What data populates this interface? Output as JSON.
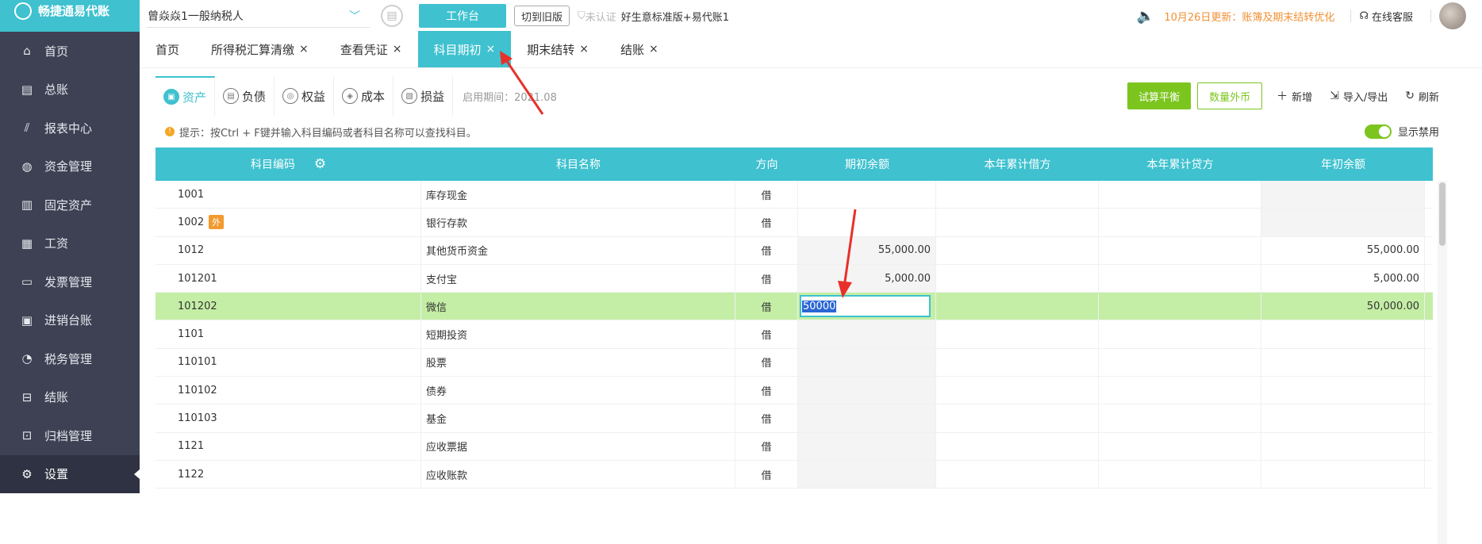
{
  "brand": {
    "name": "畅捷通易代账"
  },
  "sidebar": {
    "items": [
      {
        "label": "首页",
        "icon": "home-icon"
      },
      {
        "label": "总账",
        "icon": "ledger-icon"
      },
      {
        "label": "报表中心",
        "icon": "chart-icon"
      },
      {
        "label": "资金管理",
        "icon": "money-bag-icon"
      },
      {
        "label": "固定资产",
        "icon": "building-icon"
      },
      {
        "label": "工资",
        "icon": "salary-icon"
      },
      {
        "label": "发票管理",
        "icon": "invoice-icon"
      },
      {
        "label": "进销台账",
        "icon": "inventory-icon"
      },
      {
        "label": "税务管理",
        "icon": "tax-icon"
      },
      {
        "label": "结账",
        "icon": "close-account-icon"
      },
      {
        "label": "归档管理",
        "icon": "archive-icon"
      },
      {
        "label": "设置",
        "icon": "gear-icon"
      }
    ]
  },
  "topbar": {
    "company": "曾焱焱1一般纳税人",
    "workbench_label": "工作台",
    "old_version_label": "切到旧版",
    "uncertified_label": "未认证",
    "edition": "好生意标准版+易代账1",
    "update_notice": "10月26日更新：账簿及期末结转优化",
    "service_label": "在线客服"
  },
  "tabs": [
    {
      "label": "首页",
      "closable": false
    },
    {
      "label": "所得税汇算清缴",
      "closable": true
    },
    {
      "label": "查看凭证",
      "closable": true
    },
    {
      "label": "科目期初",
      "closable": true,
      "active": true
    },
    {
      "label": "期末结转",
      "closable": true
    },
    {
      "label": "结账",
      "closable": true
    }
  ],
  "subtabs": [
    {
      "label": "资产",
      "active": true
    },
    {
      "label": "负债"
    },
    {
      "label": "权益"
    },
    {
      "label": "成本"
    },
    {
      "label": "损益"
    }
  ],
  "period_label": "启用期间：2021.08",
  "actions": {
    "trial_balance": "试算平衡",
    "quantity_fx": "数量外币",
    "add": "新增",
    "import_export": "导入/导出",
    "refresh": "刷新"
  },
  "tip": "提示：按Ctrl + F键并输入科目编码或者科目名称可以查找科目。",
  "show_disabled_label": "显示禁用",
  "table": {
    "headers": [
      "科目编码",
      "科目名称",
      "方向",
      "期初余额",
      "本年累计借方",
      "本年累计贷方",
      "年初余额"
    ],
    "foreign_badge": "外",
    "editing_value": "50000",
    "rows": [
      {
        "code": "1001",
        "name": "库存现金",
        "dir": "借",
        "open": "",
        "debit": "",
        "credit": "",
        "year": ""
      },
      {
        "code": "1002",
        "name": "银行存款",
        "dir": "借",
        "open": "",
        "debit": "",
        "credit": "",
        "year": "",
        "foreign": true
      },
      {
        "code": "1012",
        "name": "其他货币资金",
        "dir": "借",
        "open": "55,000.00",
        "debit": "",
        "credit": "",
        "year": "55,000.00"
      },
      {
        "code": "101201",
        "name": "支付宝",
        "dir": "借",
        "open": "5,000.00",
        "debit": "",
        "credit": "",
        "year": "5,000.00"
      },
      {
        "code": "101202",
        "name": "微信",
        "dir": "借",
        "open": "",
        "debit": "",
        "credit": "",
        "year": "50,000.00",
        "selected": true
      },
      {
        "code": "1101",
        "name": "短期投资",
        "dir": "借",
        "open": "",
        "debit": "",
        "credit": "",
        "year": ""
      },
      {
        "code": "110101",
        "name": "股票",
        "dir": "借",
        "open": "",
        "debit": "",
        "credit": "",
        "year": ""
      },
      {
        "code": "110102",
        "name": "债券",
        "dir": "借",
        "open": "",
        "debit": "",
        "credit": "",
        "year": ""
      },
      {
        "code": "110103",
        "name": "基金",
        "dir": "借",
        "open": "",
        "debit": "",
        "credit": "",
        "year": ""
      },
      {
        "code": "1121",
        "name": "应收票据",
        "dir": "借",
        "open": "",
        "debit": "",
        "credit": "",
        "year": ""
      },
      {
        "code": "1122",
        "name": "应收账款",
        "dir": "借",
        "open": "",
        "debit": "",
        "credit": "",
        "year": ""
      }
    ]
  },
  "colors": {
    "accent": "#3fc1cf",
    "green": "#7cc51f",
    "sidebar": "#3d4153",
    "selected_row": "#c4eea5",
    "annotation": "#e8302a"
  }
}
